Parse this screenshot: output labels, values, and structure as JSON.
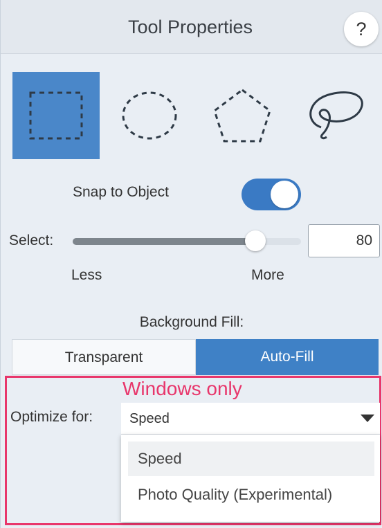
{
  "header": {
    "title": "Tool Properties",
    "help_label": "?"
  },
  "tools": [
    {
      "name": "rectangle-selection",
      "selected": true
    },
    {
      "name": "ellipse-selection",
      "selected": false
    },
    {
      "name": "polygon-selection",
      "selected": false
    },
    {
      "name": "lasso-selection",
      "selected": false
    }
  ],
  "snap": {
    "label": "Snap to Object",
    "enabled": true
  },
  "select": {
    "label": "Select:",
    "value": "80",
    "min_label": "Less",
    "max_label": "More",
    "level_percent": 80
  },
  "background_fill": {
    "label": "Background Fill:",
    "options": [
      "Transparent",
      "Auto-Fill"
    ],
    "selected": "Auto-Fill"
  },
  "annotation": {
    "text": "Windows only",
    "color": "#e8366b"
  },
  "optimize": {
    "label": "Optimize for:",
    "value": "Speed",
    "options": [
      "Speed",
      "Photo Quality (Experimental)"
    ]
  },
  "colors": {
    "accent": "#4a87c9",
    "toggle": "#3a7ac4",
    "highlight": "#e8366b"
  }
}
